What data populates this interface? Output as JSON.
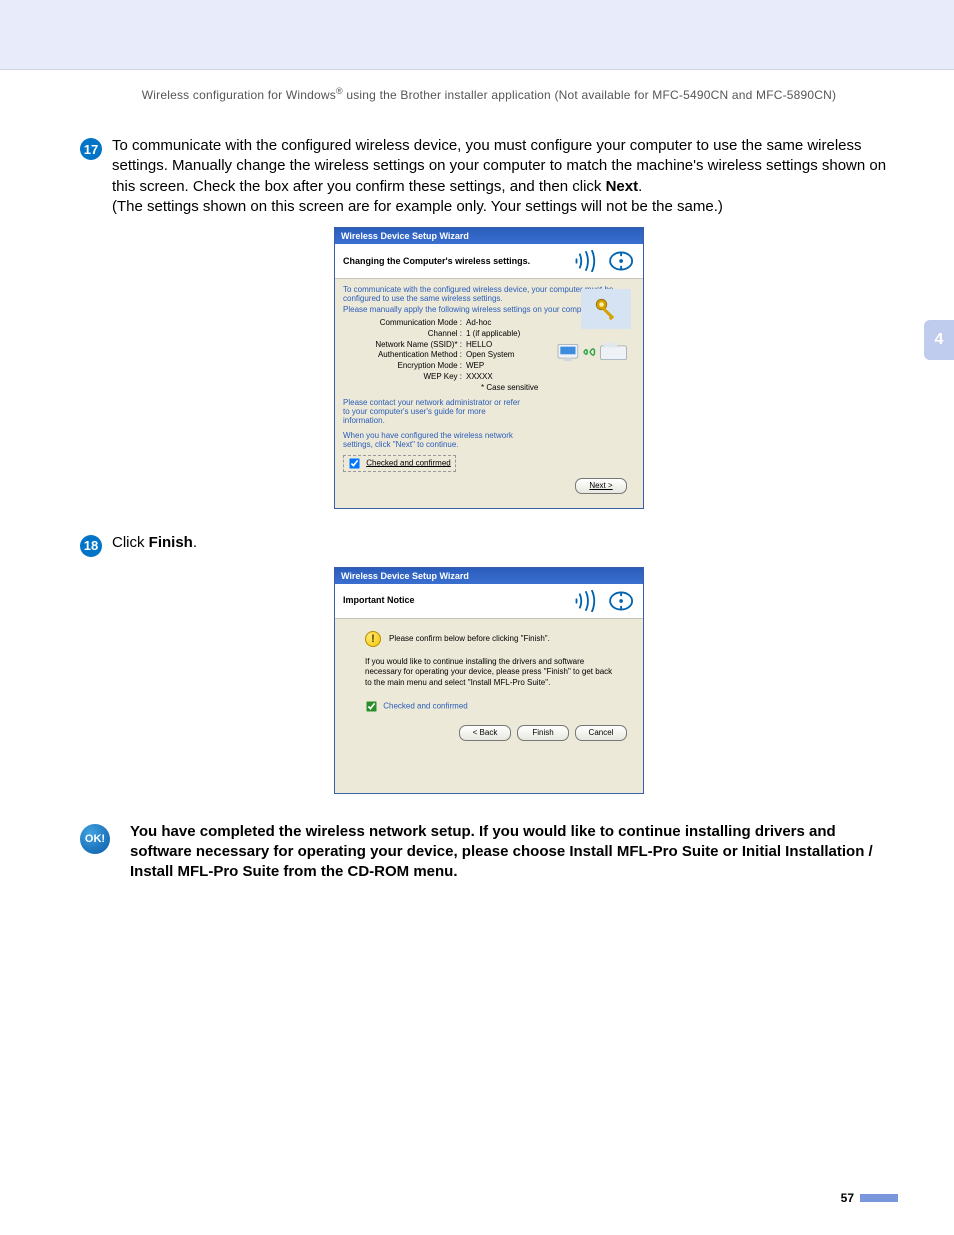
{
  "header": {
    "text_before": "Wireless configuration for Windows",
    "reg": "®",
    "text_after": " using the Brother installer application (Not available for MFC-5490CN and MFC-5890CN)"
  },
  "step17": {
    "num": "17",
    "p1_a": "To communicate with the configured wireless device, you must configure your computer to use the same wireless settings. Manually change the wireless settings on your computer to match the machine's wireless settings shown on this screen. Check the box after you confirm these settings, and then click ",
    "p1_bold": "Next",
    "p1_b": ".",
    "p2": "(The settings shown on this screen are for example only. Your settings will not be the same.)"
  },
  "dialog1": {
    "title": "Wireless Device Setup Wizard",
    "head": "Changing the Computer's wireless settings.",
    "intro1": "To communicate with the configured wireless device, your computer must be configured to use the same wireless settings.",
    "intro2": "Please manually apply the following wireless settings on your computer.",
    "rows": [
      {
        "lbl": "Communication Mode :",
        "val": "Ad-hoc"
      },
      {
        "lbl": "Channel :",
        "val": "1      (if applicable)"
      },
      {
        "lbl": "Network Name (SSID)* :",
        "val": "HELLO"
      },
      {
        "lbl": "Authentication Method :",
        "val": "Open System"
      },
      {
        "lbl": "Encryption Mode :",
        "val": "WEP"
      },
      {
        "lbl": "WEP Key :",
        "val": "XXXXX"
      }
    ],
    "case": "* Case sensitive",
    "contact": "Please contact your network administrator or refer to your computer's user's guide for more information.",
    "confirm": "When you have configured the wireless network settings, click \"Next\" to continue.",
    "checkbox": "Checked and confirmed",
    "btn_next": "Next >"
  },
  "step18": {
    "num": "18",
    "text_a": "Click ",
    "text_bold": "Finish",
    "text_b": "."
  },
  "dialog2": {
    "title": "Wireless Device Setup Wizard",
    "head": "Important Notice",
    "notice": "Please confirm below before clicking \"Finish\".",
    "body": "If you would like to continue installing the drivers and software necessary for operating your device, please press \"Finish\" to get back to the main menu and select \"Install MFL-Pro Suite\".",
    "checkbox": "Checked and confirmed",
    "btn_back": "< Back",
    "btn_finish": "Finish",
    "btn_cancel": "Cancel"
  },
  "ok": {
    "label": "OK!",
    "text": "You have completed the wireless network setup. If you would like to continue installing drivers and software necessary for operating your device, please choose Install MFL-Pro Suite or Initial Installation / Install MFL-Pro Suite from the CD-ROM menu."
  },
  "side_tab": "4",
  "page_num": "57"
}
